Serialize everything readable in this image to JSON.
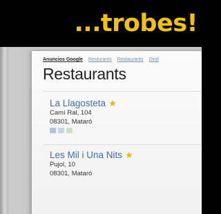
{
  "banner": {
    "title": "...trobes!"
  },
  "ads": {
    "label": "Anuncios Google",
    "links": [
      "Resturants",
      "Restaurants",
      "Dirid"
    ]
  },
  "page": {
    "title": "Restaurants"
  },
  "restaurants": [
    {
      "name": "La Llagosteta",
      "street": "Camí Ral, 104",
      "city": "08301, Mataró"
    },
    {
      "name": "Les Mil i Una Nits",
      "street": "Pujol, 10",
      "city": "08301, Mataró"
    }
  ]
}
